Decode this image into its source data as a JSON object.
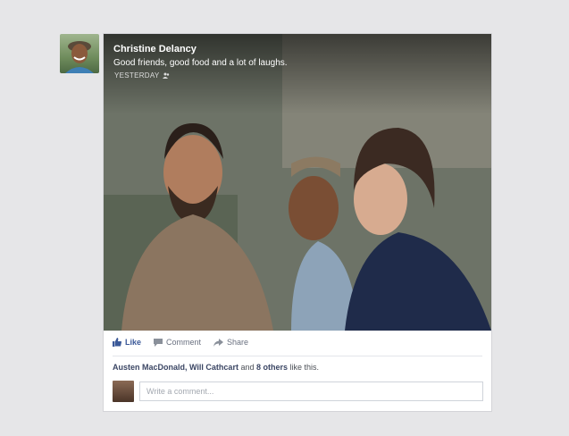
{
  "post": {
    "author": "Christine Delancy",
    "caption": "Good friends, good food and a lot of laughs.",
    "timestamp": "YESTERDAY",
    "audience_icon": "people-icon"
  },
  "actions": {
    "like_label": "Like",
    "comment_label": "Comment",
    "share_label": "Share"
  },
  "likes": {
    "names": "Austen MacDonald, Will Cathcart",
    "and_text": "and",
    "others": "8 others",
    "suffix": "like this."
  },
  "comment": {
    "placeholder": "Write a comment..."
  },
  "colors": {
    "background": "#e6e6e8",
    "brand_blue": "#3b5998",
    "action_gray": "#6a7180"
  }
}
